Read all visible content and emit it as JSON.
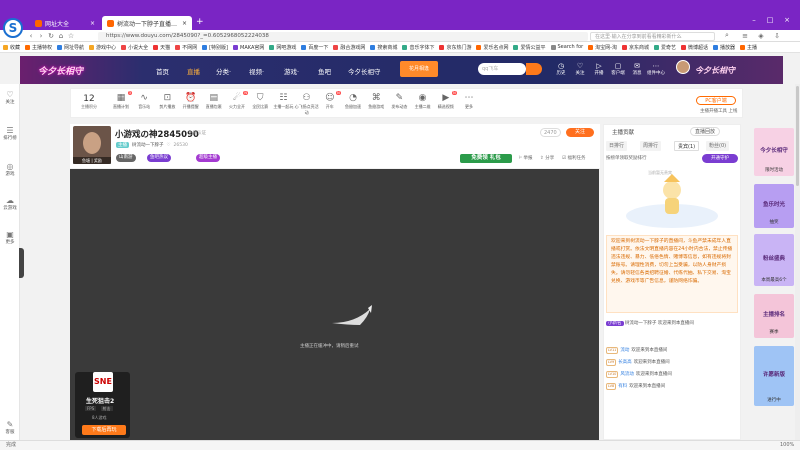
{
  "browser": {
    "tabs": [
      {
        "label": "网址大全",
        "active": false
      },
      {
        "label": "树流动一下脖子直播_主",
        "active": true
      }
    ],
    "url": "https://www.douyu.com/2845090?_=0.6052968052224038",
    "search_placeholder": "在这里·输入在分享到前看看精彩新什么",
    "window_controls": [
      "–",
      "□",
      "×"
    ],
    "status_left": "完成",
    "status_zoom": "100%"
  },
  "bookmarks": [
    {
      "label": "收藏",
      "color": "#f6a623"
    },
    {
      "label": "主播特权",
      "color": "#ff6a00"
    },
    {
      "label": "网址导航",
      "color": "#2e7de0"
    },
    {
      "label": "游戏中心",
      "color": "#f5a623"
    },
    {
      "label": "小说大全",
      "color": "#e44"
    },
    {
      "label": "天猫",
      "color": "#e33"
    },
    {
      "label": "不网网",
      "color": "#e44"
    },
    {
      "label": "[特别版]",
      "color": "#2e7de0"
    },
    {
      "label": "MAKA官网",
      "color": "#7a3dd1"
    },
    {
      "label": "网吧游戏",
      "color": "#3a8"
    },
    {
      "label": "百度一下",
      "color": "#2e7de0"
    },
    {
      "label": "融合游戏网",
      "color": "#e44"
    },
    {
      "label": "搜索商城",
      "color": "#2e7de0"
    },
    {
      "label": "音乐字体下",
      "color": "#3a8"
    },
    {
      "label": "京东热门游",
      "color": "#e33"
    },
    {
      "label": "爱乐名点网",
      "color": "#f60"
    },
    {
      "label": "爱情公益平",
      "color": "#3a8"
    },
    {
      "label": "Search for",
      "color": "#888"
    },
    {
      "label": "淘宝网-淘",
      "color": "#f60"
    },
    {
      "label": "京东商城",
      "color": "#e33"
    },
    {
      "label": "爱奇艺",
      "color": "#3a8"
    },
    {
      "label": "微博超话",
      "color": "#e33"
    },
    {
      "label": "播放器",
      "color": "#2e7de0"
    },
    {
      "label": "主播",
      "color": "#f60"
    }
  ],
  "site_header": {
    "banner_text": "今夕长相守",
    "nav": [
      {
        "label": "首页",
        "active": false
      },
      {
        "label": "直播",
        "active": true
      },
      {
        "label": "分类·",
        "active": false
      },
      {
        "label": "视频·",
        "active": false
      },
      {
        "label": "游戏·",
        "active": false
      },
      {
        "label": "鱼吧",
        "active": false
      },
      {
        "label": "今夕长相守",
        "active": false
      }
    ],
    "promo": "花月相逢",
    "search_placeholder": "qq飞车",
    "icons": [
      {
        "name": "history",
        "label": "历史"
      },
      {
        "name": "follow",
        "label": "关注"
      },
      {
        "name": "broadcast",
        "label": "开播"
      },
      {
        "name": "client",
        "label": "客户端"
      },
      {
        "name": "message",
        "label": "消息"
      },
      {
        "name": "more",
        "label": "组件中心"
      }
    ]
  },
  "left_sidebar": [
    {
      "icon": "heart-icon",
      "label": "关注"
    },
    {
      "icon": "rank-icon",
      "label": "排行榜"
    },
    {
      "icon": "game-icon",
      "label": "游戏"
    },
    {
      "icon": "shop-icon",
      "label": "云游戏"
    },
    {
      "icon": "more-icon",
      "label": "更多"
    },
    {
      "icon": "feedback-icon",
      "label": "客服"
    }
  ],
  "toolbar": {
    "level_num": "12",
    "level_label": "主播积分",
    "items": [
      {
        "icon": "calendar-icon",
        "label": "直播计划",
        "badge": "3"
      },
      {
        "icon": "waveform-icon",
        "label": "音乐站"
      },
      {
        "icon": "clip-icon",
        "label": "剪片播放"
      },
      {
        "icon": "alarm-icon",
        "label": "开播提醒"
      },
      {
        "icon": "box-icon",
        "label": "直播包裹"
      },
      {
        "icon": "rocket-icon",
        "label": "火力全开",
        "badge": "N"
      },
      {
        "icon": "shield-icon",
        "label": "全民比赛"
      },
      {
        "icon": "task-icon",
        "label": "主播一起玩"
      },
      {
        "icon": "group-icon",
        "label": "心飞扬点亮活动"
      },
      {
        "icon": "user-icon",
        "label": "开车",
        "badge": "N"
      },
      {
        "icon": "speed-icon",
        "label": "鱼翅加速"
      },
      {
        "icon": "gamepad-icon",
        "label": "鱼翅游戏"
      },
      {
        "icon": "signal-icon",
        "label": "发布动态"
      },
      {
        "icon": "bell-icon",
        "label": "主播二维"
      },
      {
        "icon": "video-icon",
        "label": "精选视频",
        "badge": "N"
      },
      {
        "icon": "ellipsis-icon",
        "label": "更多"
      }
    ],
    "pc_button": "PC客户端",
    "pc_link": "主播开播工具 上线"
  },
  "streamer": {
    "title": "小游戏の神2845090",
    "title_tag": "主播认证",
    "owner_label": "树流动一下脖子",
    "owner_badge": "主播",
    "fans_count": "26530",
    "room_id_label": "2845090",
    "tag_label": "山南游",
    "tag2": "鱼吧热议",
    "tag3": "超级主播",
    "fans": "2470",
    "follow": "关注",
    "free_gift": "免费领 礼包",
    "actions": [
      "举报",
      "分享",
      "福利任务"
    ],
    "avatar_caption": "鱼塘   |  奖励"
  },
  "video": {
    "message": "主播正在缓冲中，请稍后重试",
    "game_card": {
      "logo": "SNE",
      "name": "生死狙击2",
      "tags": [
        "FPS",
        "射击"
      ],
      "players": "8人游戏",
      "button": "下载后再玩"
    }
  },
  "right_panel": {
    "header_left": "主播贡献",
    "header_right": "直播回放",
    "tabs": [
      {
        "label": "日排行",
        "active": false
      },
      {
        "label": "周排行",
        "active": false
      },
      {
        "label": "贵宾(1)",
        "active": true
      },
      {
        "label": "粉丝(0)",
        "active": false
      }
    ],
    "guard_text": "按榜单领取奖励排行",
    "guard_button": "开通守护",
    "empty_text": "当前暂无贵宾",
    "notice": "欢迎来到树流动一下脖子的直播间，斗鱼严禁未成年人直播或打赏。依法文明直播内容在24小时内合法，禁止传播违法违规、暴力、低俗色情、赌博等信息，如有违规将封禁账号。请理性消费，切勿上当受骗，以防人身财产损失。请勿轻信各类招聘征婚、代练代抽、私下交易、淘宝兑换、游戏币等广告信息，谨防网络诈骗。",
    "user_line": "树流动一下脖子 欢迎来到本直播间",
    "user_badge": "小新名",
    "chat": [
      {
        "level": "LV11",
        "nick": "流动",
        "text": "欢迎来到本直播间"
      },
      {
        "level": "LV9",
        "nick": "长高高",
        "text": "欢迎来到本直播间"
      },
      {
        "level": "LV10",
        "nick": "风流动",
        "text": "欢迎来到本直播间"
      },
      {
        "level": "LV8",
        "nick": "有料",
        "text": "欢迎来到本直播间"
      }
    ]
  },
  "right_ads": [
    {
      "label": "今夕长相守",
      "sub": "限时活动",
      "color": "#f7d1e4"
    },
    {
      "label": "鱼乐时光",
      "sub": "抽奖",
      "color": "#b79ef2"
    },
    {
      "label": "粉丝盛典",
      "sub": "本周最高6个",
      "color": "#c9b4f5"
    },
    {
      "label": "主播排名",
      "sub": "赛季",
      "color": "#f4c5d9"
    },
    {
      "label": "许愿新版",
      "sub": "进行中",
      "color": "#9fc4f5"
    }
  ]
}
